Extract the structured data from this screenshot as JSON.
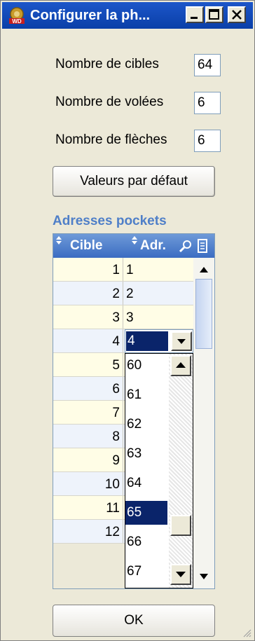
{
  "window": {
    "title": "Configurer la ph..."
  },
  "fields": {
    "targets": {
      "label": "Nombre de cibles",
      "value": "64"
    },
    "volleys": {
      "label": "Nombre de volées",
      "value": "6"
    },
    "arrows": {
      "label": "Nombre de flèches",
      "value": "6"
    }
  },
  "defaults_button": "Valeurs par défaut",
  "section_title": "Adresses pockets",
  "table": {
    "columns": [
      "Cible",
      "Adr."
    ],
    "rows": [
      {
        "cible": "1",
        "adr": "1"
      },
      {
        "cible": "2",
        "adr": "2"
      },
      {
        "cible": "3",
        "adr": "3"
      },
      {
        "cible": "4",
        "adr": "4"
      },
      {
        "cible": "5",
        "adr": ""
      },
      {
        "cible": "6",
        "adr": ""
      },
      {
        "cible": "7",
        "adr": ""
      },
      {
        "cible": "8",
        "adr": ""
      },
      {
        "cible": "9",
        "adr": ""
      },
      {
        "cible": "10",
        "adr": ""
      },
      {
        "cible": "11",
        "adr": ""
      },
      {
        "cible": "12",
        "adr": ""
      }
    ],
    "dropdown_options": [
      "60",
      "61",
      "62",
      "63",
      "64",
      "65",
      "66",
      "67"
    ],
    "selected_option": "65"
  },
  "ok_button": "OK",
  "colors": {
    "title_bar": "#0a3fa8",
    "header": "#3b6cc2",
    "row_odd": "#fffde6",
    "row_even": "#eef3fb",
    "selection": "#0a246a",
    "section_text": "#4f7fc8"
  }
}
